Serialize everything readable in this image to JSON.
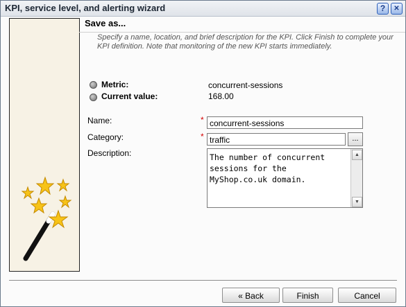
{
  "window": {
    "title": "KPI, service level, and alerting wizard",
    "help_icon": "?",
    "close_icon": "✕"
  },
  "step": {
    "heading": "Save as...",
    "instructions": "Specify a name, location, and brief description for the KPI. Click Finish to complete your KPI definition. Note that monitoring of the new KPI starts immediately."
  },
  "metric": {
    "label": "Metric:",
    "value": "concurrent-sessions"
  },
  "current": {
    "label": "Current value:",
    "value": "168.00"
  },
  "form": {
    "required_marker": "*",
    "name": {
      "label": "Name:",
      "value": "concurrent-sessions"
    },
    "category": {
      "label": "Category:",
      "value": "traffic",
      "browse_label": "..."
    },
    "description": {
      "label": "Description:",
      "value": "The number of concurrent\nsessions for the\nMyShop.co.uk domain."
    }
  },
  "buttons": {
    "back": "« Back",
    "finish": "Finish",
    "cancel": "Cancel"
  },
  "colors": {
    "title_text": "#1c2633",
    "required": "#d40000",
    "wizard_panel_bg": "#f7f2e5",
    "star": "#f7c318"
  }
}
